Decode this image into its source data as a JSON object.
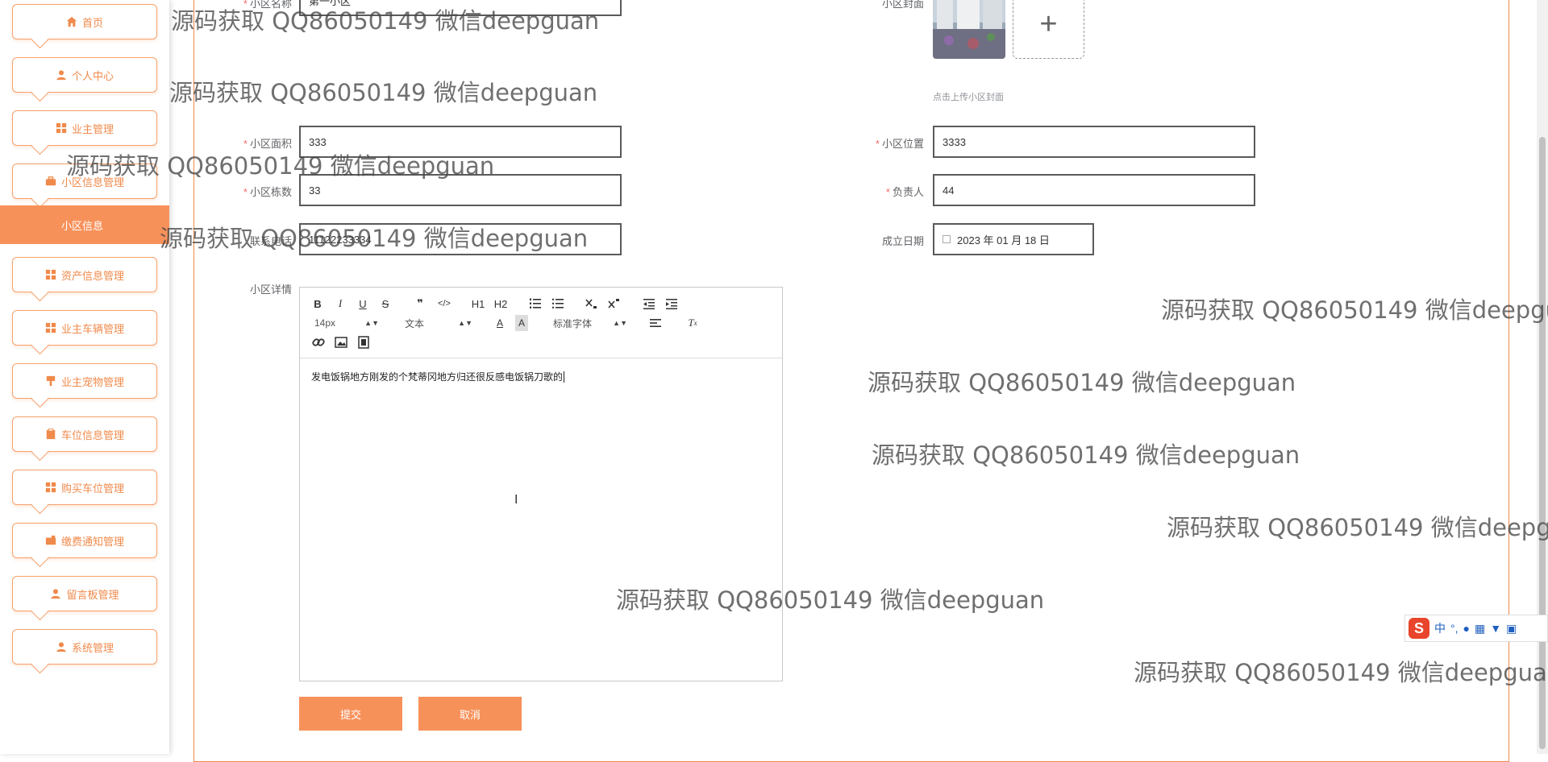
{
  "sidebar": {
    "items": [
      {
        "label": "首页",
        "icon": "home-icon"
      },
      {
        "label": "个人中心",
        "icon": "user-icon"
      },
      {
        "label": "业主管理",
        "icon": "grid-icon"
      },
      {
        "label": "小区信息管理",
        "icon": "briefcase-icon"
      },
      {
        "label": "资产信息管理",
        "icon": "grid-icon"
      },
      {
        "label": "业主车辆管理",
        "icon": "grid-icon"
      },
      {
        "label": "业主宠物管理",
        "icon": "pin-icon"
      },
      {
        "label": "车位信息管理",
        "icon": "clipboard-icon"
      },
      {
        "label": "购买车位管理",
        "icon": "grid-icon"
      },
      {
        "label": "缴费通知管理",
        "icon": "wallet-icon"
      },
      {
        "label": "留言板管理",
        "icon": "user-icon"
      },
      {
        "label": "系统管理",
        "icon": "user-icon"
      }
    ],
    "active_sub": "小区信息"
  },
  "form": {
    "name": {
      "label": "小区名称",
      "value": "第一小区"
    },
    "cover": {
      "label": "小区封面",
      "hint": "点击上传小区封面",
      "plus": "+"
    },
    "area": {
      "label": "小区面积",
      "value": "333"
    },
    "location": {
      "label": "小区位置",
      "value": "3333"
    },
    "buildings": {
      "label": "小区栋数",
      "value": "33"
    },
    "manager": {
      "label": "负责人",
      "value": "44"
    },
    "phone": {
      "label": "联系电话",
      "value": "11122233334"
    },
    "founded": {
      "label": "成立日期",
      "value": "2023 年 01 月 18 日"
    },
    "detail": {
      "label": "小区详情",
      "content": "发电饭锅地方刚发的个梵蒂冈地方归还很反感电饭锅刀歌的"
    },
    "required_mark": "*"
  },
  "editor": {
    "font_size": "14px",
    "block_type": "文本",
    "font_family": "标准字体",
    "buttons": [
      "B",
      "I",
      "U",
      "S",
      "❞",
      "</>",
      "H1",
      "H2"
    ]
  },
  "actions": {
    "submit": "提交",
    "cancel": "取消"
  },
  "watermark": "源码获取 QQ86050149 微信deepguan",
  "ime": {
    "logo": "S",
    "lang": "中",
    "punct": "°,"
  },
  "colors": {
    "accent": "#f7915a",
    "accent_border": "#f08a4b",
    "required": "#f56c6c"
  }
}
